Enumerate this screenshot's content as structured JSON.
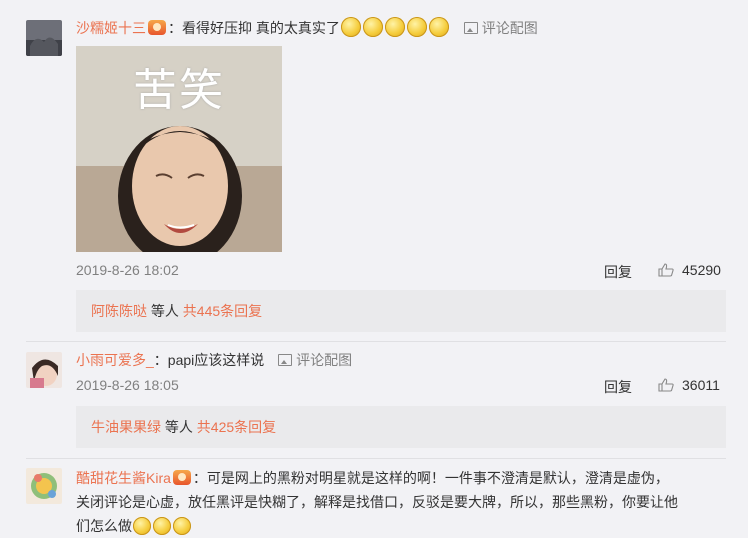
{
  "comments": [
    {
      "username": "沙糯姬十三",
      "text": "：看得好压抑 真的太真实了",
      "image_caption": "苦笑",
      "comment_image_btn": "评论配图",
      "time": "2019-8-26 18:02",
      "reply_label": "回复",
      "likes": "45290",
      "sub_reply_user": "阿陈陈哒",
      "sub_reply_mid": " 等人 ",
      "sub_reply_count": "共445条回复"
    },
    {
      "username": "小雨可爱多_",
      "text": "：papi应该这样说",
      "comment_image_btn": "评论配图",
      "time": "2019-8-26 18:05",
      "reply_label": "回复",
      "likes": "36011",
      "sub_reply_user": "牛油果果绿",
      "sub_reply_mid": " 等人 ",
      "sub_reply_count": "共425条回复"
    },
    {
      "username": "酷甜花生酱Kira",
      "text_line1": "：可是网上的黑粉对明星就是这样的啊！一件事不澄清是默认，澄清是虚伪，",
      "text_line2": "关闭评论是心虚，放任黑评是快糊了，解释是找借口，反驳是要大牌，所以，那些黑粉，你要让他",
      "text_line3": "们怎么做"
    }
  ],
  "icons": {
    "badge": "vip-badge-icon",
    "emoji": "doge-emoji-icon",
    "like": "thumbs-up-icon",
    "picture": "picture-icon"
  },
  "colors": {
    "username": "#eb7350",
    "background": "#f2f2f5",
    "reply_box": "#eaeaec"
  }
}
